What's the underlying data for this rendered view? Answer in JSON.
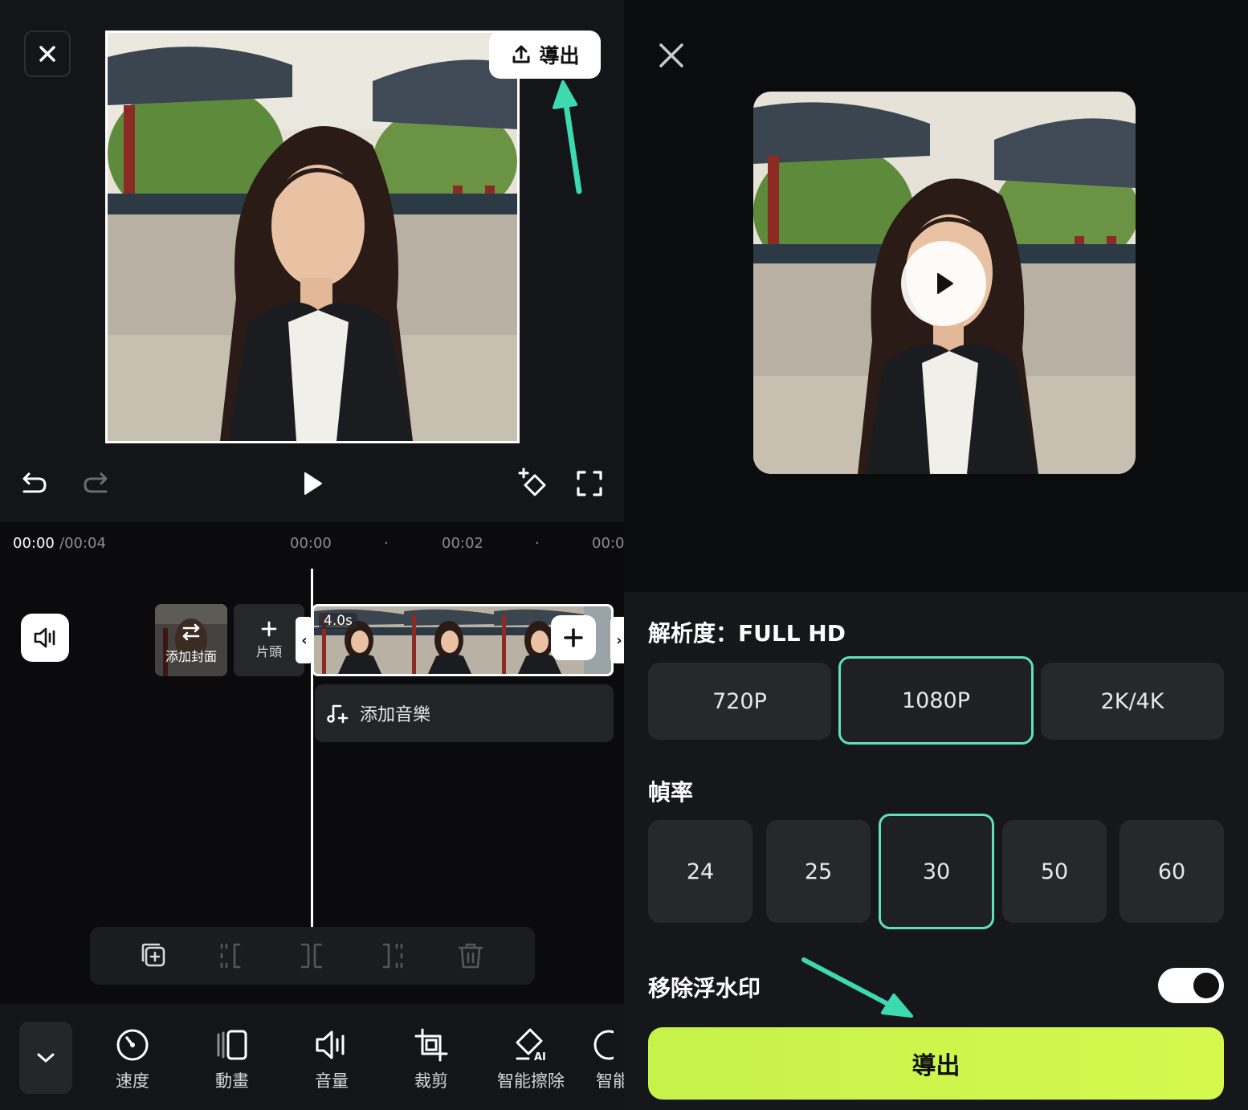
{
  "editor": {
    "export_label": "導出",
    "time_current": "00:00",
    "time_total": "/00:04",
    "ruler": [
      "00:00",
      "·",
      "00:02",
      "·",
      "00:0"
    ],
    "cover_label": "添加封面",
    "intro_label": "片頭",
    "clip_duration": "4.0s",
    "music_label": "添加音樂",
    "tools": [
      {
        "label": "速度",
        "icon": "speed-icon"
      },
      {
        "label": "動畫",
        "icon": "animation-icon"
      },
      {
        "label": "音量",
        "icon": "volume-icon"
      },
      {
        "label": "裁剪",
        "icon": "crop-icon"
      },
      {
        "label": "智能擦除",
        "icon": "ai-erase-icon"
      },
      {
        "label": "智能",
        "icon": "smart-icon"
      }
    ],
    "edit_actions": [
      "copy-icon",
      "split-left-icon",
      "split-icon",
      "split-right-icon",
      "delete-icon"
    ]
  },
  "export_panel": {
    "resolution_title": "解析度：FULL HD",
    "resolutions": [
      "720P",
      "1080P",
      "2K/4K"
    ],
    "selected_resolution": "1080P",
    "framerate_title": "幀率",
    "framerates": [
      "24",
      "25",
      "30",
      "50",
      "60"
    ],
    "selected_framerate": "30",
    "watermark_label": "移除浮水印",
    "watermark_on": true,
    "export_button": "導出"
  },
  "colors": {
    "accent_teal": "#5fe0be",
    "export_green": "#c6f24a",
    "annotation_arrow": "#3dd9b0"
  }
}
